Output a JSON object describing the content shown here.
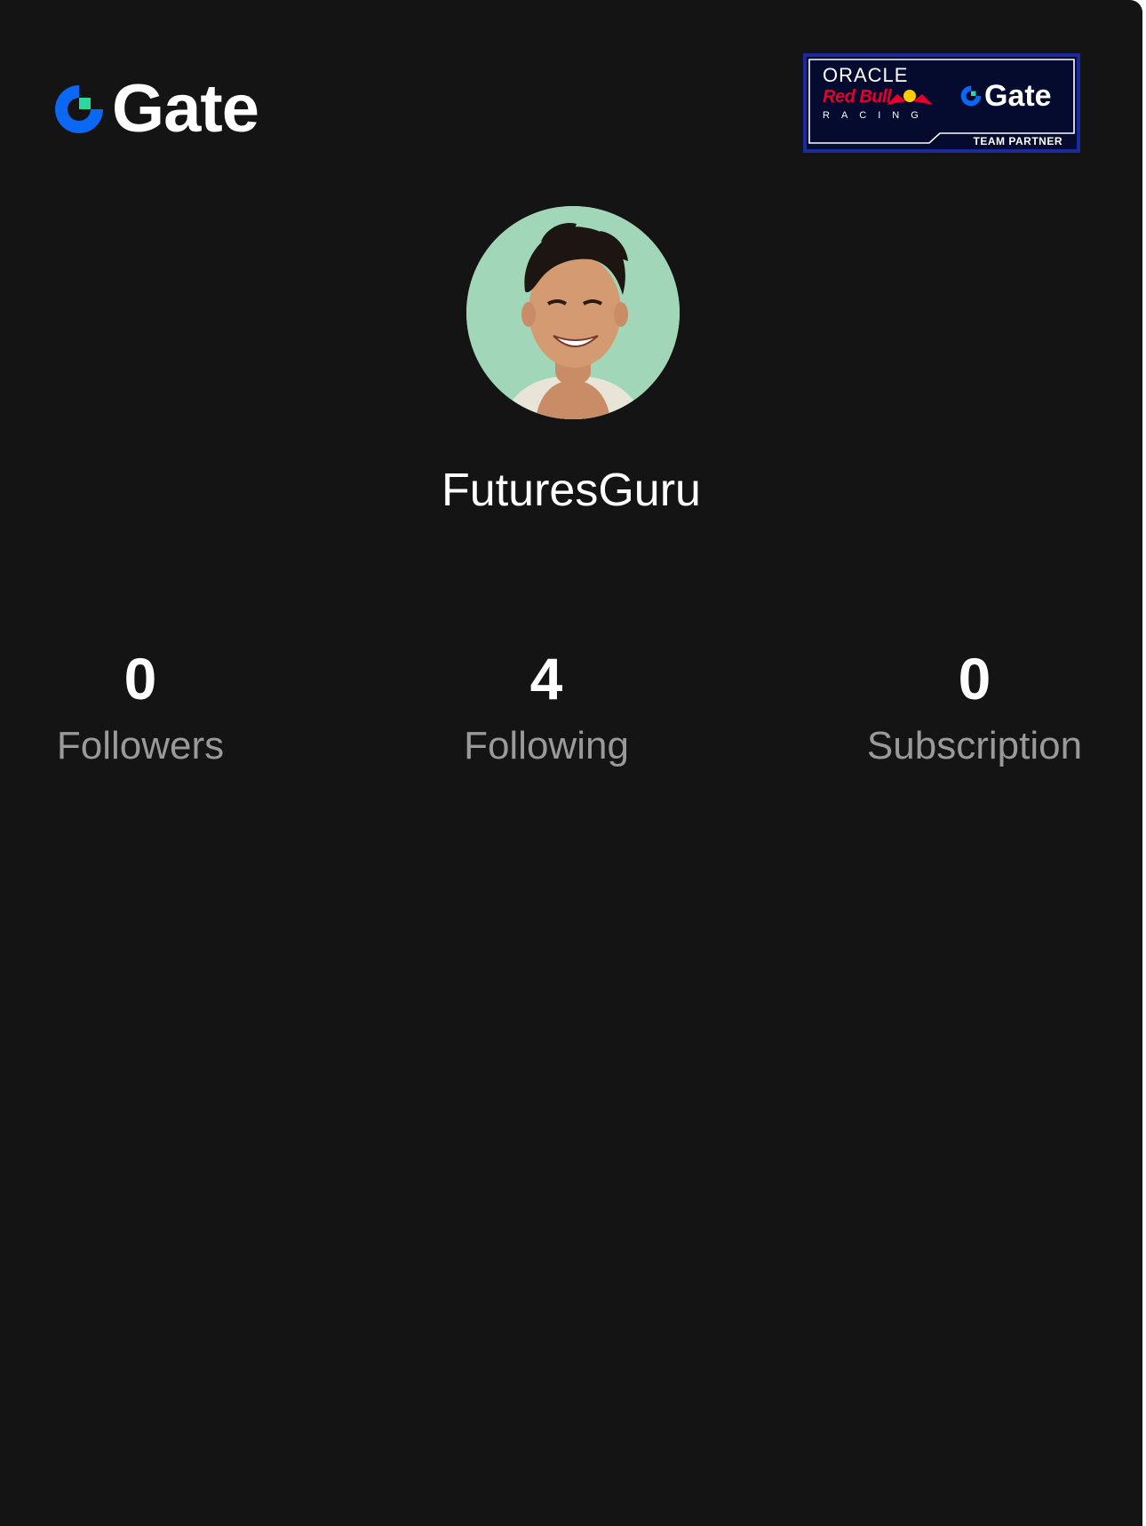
{
  "brand": {
    "name": "Gate",
    "colors": {
      "blue": "#0a68f4",
      "green": "#2bd9a0",
      "background": "#141414",
      "label_gray": "#9a9a9a"
    }
  },
  "partner_badge": {
    "line1": "ORACLE",
    "line2": "Red Bull",
    "line3": "RACING",
    "partner_name": "Gate",
    "caption": "TEAM PARTNER"
  },
  "profile": {
    "avatar": "avatar-photo",
    "username": "FuturesGuru"
  },
  "stats": [
    {
      "value": "0",
      "label": "Followers"
    },
    {
      "value": "4",
      "label": "Following"
    },
    {
      "value": "0",
      "label": "Subscription"
    }
  ]
}
